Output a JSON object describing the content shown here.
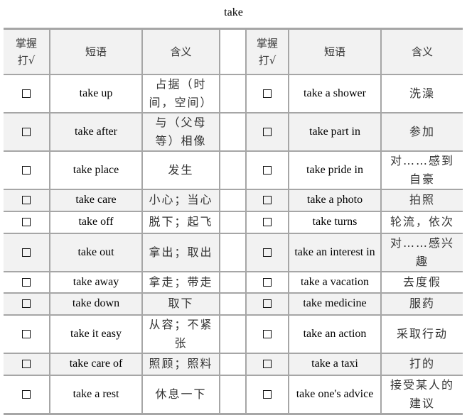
{
  "title": "take",
  "header": {
    "mastered": "掌握打√",
    "phrase": "短语",
    "meaning": "含义"
  },
  "checkbox_glyph": "☐",
  "rows": [
    {
      "left": {
        "phrase": "take up",
        "meaning": "占据（时间，空间）",
        "checked": false
      },
      "right": {
        "phrase": "take a shower",
        "meaning": "洗澡",
        "checked": false
      }
    },
    {
      "left": {
        "phrase": "take after",
        "meaning": "与（父母等）相像",
        "checked": false
      },
      "right": {
        "phrase": "take part in",
        "meaning": "参加",
        "checked": false
      }
    },
    {
      "left": {
        "phrase": "take place",
        "meaning": "发生",
        "checked": false
      },
      "right": {
        "phrase": "take pride in",
        "meaning": "对……感到自豪",
        "checked": false
      }
    },
    {
      "left": {
        "phrase": "take care",
        "meaning": "小心；当心",
        "checked": false
      },
      "right": {
        "phrase": "take a photo",
        "meaning": "拍照",
        "checked": false
      }
    },
    {
      "left": {
        "phrase": "take off",
        "meaning": "脱下；起飞",
        "checked": false
      },
      "right": {
        "phrase": "take turns",
        "meaning": "轮流，依次",
        "checked": false
      }
    },
    {
      "left": {
        "phrase": "take out",
        "meaning": "拿出；取出",
        "checked": false
      },
      "right": {
        "phrase": "take an interest in",
        "meaning": "对……感兴趣",
        "checked": false
      }
    },
    {
      "left": {
        "phrase": "take away",
        "meaning": "拿走；带走",
        "checked": false
      },
      "right": {
        "phrase": "take a vacation",
        "meaning": "去度假",
        "checked": false
      }
    },
    {
      "left": {
        "phrase": "take down",
        "meaning": "取下",
        "checked": false
      },
      "right": {
        "phrase": "take medicine",
        "meaning": "服药",
        "checked": false
      }
    },
    {
      "left": {
        "phrase": "take it easy",
        "meaning": "从容；不紧张",
        "checked": false
      },
      "right": {
        "phrase": "take an action",
        "meaning": "采取行动",
        "checked": false
      }
    },
    {
      "left": {
        "phrase": "take care of",
        "meaning": "照顾；照料",
        "checked": false
      },
      "right": {
        "phrase": "take a taxi",
        "meaning": "打的",
        "checked": false
      }
    },
    {
      "left": {
        "phrase": "take a rest",
        "meaning": "休息一下",
        "checked": false
      },
      "right": {
        "phrase": "take one's advice",
        "meaning": "接受某人的建议",
        "checked": false
      }
    }
  ]
}
